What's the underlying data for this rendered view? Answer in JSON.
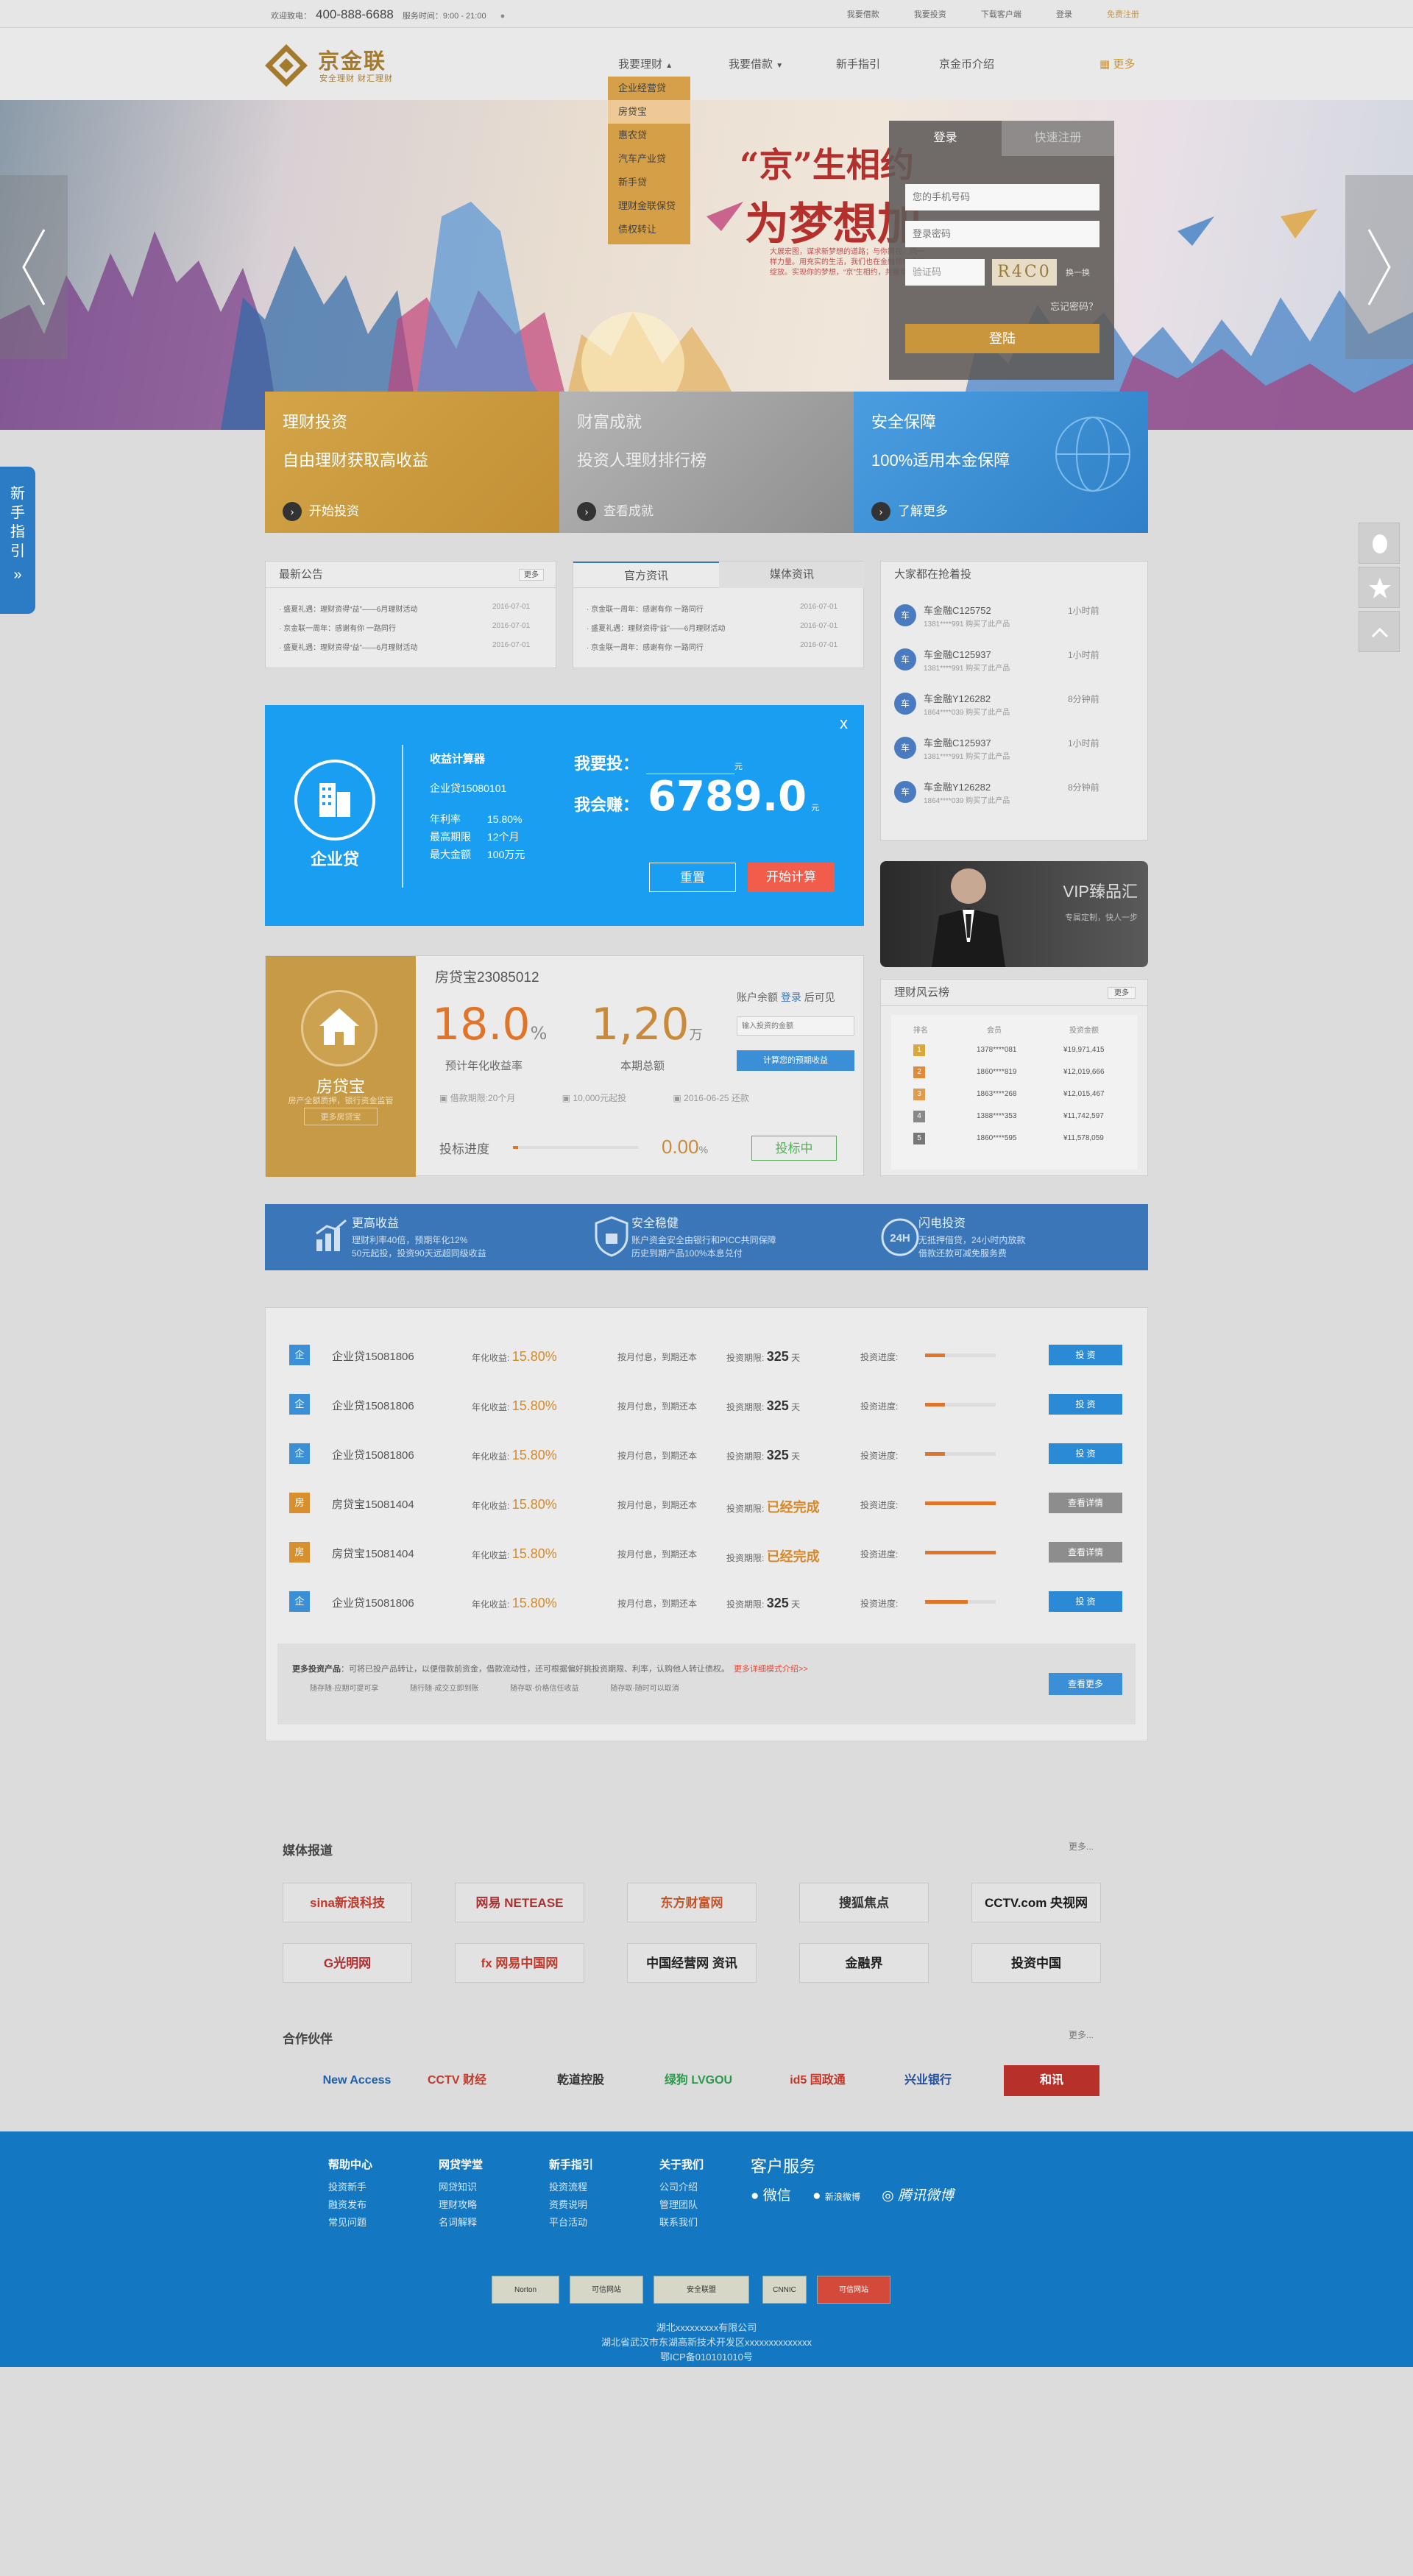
{
  "topbar": {
    "welcome": "欢迎致电：",
    "phone": "400-888-6688",
    "hours": "服务时间：9:00 - 21:00",
    "links": [
      "我要借款",
      "我要投资",
      "下载客户端",
      "登录",
      "免费注册"
    ]
  },
  "logo": {
    "name": "京金联",
    "slogan": "安全理财 财汇理财"
  },
  "nav": {
    "items": [
      "我要理财",
      "我要借款",
      "新手指引",
      "京金币介绍",
      "更多"
    ],
    "dropdown": [
      "企业经营贷",
      "房贷宝",
      "惠农贷",
      "汽车产业贷",
      "新手贷",
      "理财金联保贷",
      "债权转让"
    ]
  },
  "banner": {
    "headline1": "“京”生相约",
    "headline2": "为梦想加",
    "desc": "大展宏图，谋求新梦想的道路；与你同在，同一样力量。用充实的生活，我们也在金融领域精彩绽放。实现你的梦想，“京”生相约，共赢幸福。"
  },
  "login": {
    "tab_login": "登录",
    "tab_register": "快速注册",
    "phone_placeholder": "您的手机号码",
    "password_placeholder": "登录密码",
    "captcha_placeholder": "验证码",
    "captcha_text": "R4C0",
    "swap": "换一换",
    "forgot": "忘记密码？",
    "submit": "登陆"
  },
  "features": [
    {
      "title": "理财投资",
      "subtitle": "自由理财获取高收益",
      "action": "开始投资",
      "color": "#c99a3c"
    },
    {
      "title": "财富成就",
      "subtitle": "投资人理财排行榜",
      "action": "查看成就",
      "color": "#9a9a9a"
    },
    {
      "title": "安全保障",
      "subtitle": "100%适用本金保障",
      "action": "了解更多",
      "color": "#3a8fd4"
    }
  ],
  "side_guide": {
    "label": "新手指引",
    "arrow": "»"
  },
  "news": {
    "title": "最新公告",
    "more": "更多",
    "items": [
      {
        "text": "盛夏礼遇：理财资得“益”——6月理财活动",
        "date": "2016-07-01"
      },
      {
        "text": "京金联一周年：感谢有你 一路同行",
        "date": "2016-07-01"
      },
      {
        "text": "盛夏礼遇：理财资得“益”——6月理财活动",
        "date": "2016-07-01"
      }
    ]
  },
  "official": {
    "tab1": "官方资讯",
    "tab2": "媒体资讯",
    "items": [
      {
        "text": "京金联一周年：感谢有你 一路同行",
        "date": "2016-07-01"
      },
      {
        "text": "盛夏礼遇：理财资得“益”——6月理财活动",
        "date": "2016-07-01"
      },
      {
        "text": "京金联一周年：感谢有你 一路同行",
        "date": "2016-07-01"
      }
    ]
  },
  "rush": {
    "title": "大家都在抢着投",
    "items": [
      {
        "name": "车金融C125752",
        "phone": "1381****991 购买了此产品",
        "time": "1小时前"
      },
      {
        "name": "车金融C125937",
        "phone": "1381****991 购买了此产品",
        "time": "1小时前"
      },
      {
        "name": "车金融Y126282",
        "phone": "1864****039 购买了此产品",
        "time": "8分钟前"
      },
      {
        "name": "车金融C125937",
        "phone": "1381****991 购买了此产品",
        "time": "1小时前"
      },
      {
        "name": "车金融Y126282",
        "phone": "1864****039 购买了此产品",
        "time": "8分钟前"
      }
    ]
  },
  "modal": {
    "close": "x",
    "product_label": "企业贷",
    "calc_title": "收益计算器",
    "calc_name": "企业贷15080101",
    "rows": [
      {
        "k": "年利率",
        "v": "15.80%"
      },
      {
        "k": "最高期限",
        "v": "12个月"
      },
      {
        "k": "最大金额",
        "v": "100万元"
      }
    ],
    "invest_label": "我要投：",
    "invest_unit": "元",
    "earn_label": "我会赚：",
    "earn_value": "6789.0",
    "earn_unit": "元",
    "reset": "重置",
    "start": "开始计算"
  },
  "vip": {
    "title": "VIP臻品汇",
    "sub": "专属定制，快人一步"
  },
  "product": {
    "label": "房贷宝",
    "sub": "房产全额质押，银行资金监管",
    "btn": "更多房贷宝",
    "name": "房贷宝23085012",
    "rate": "18.0",
    "rate_unit": "%",
    "rate_label": "预计年化收益率",
    "amount": "1,20",
    "amount_unit": "万",
    "amount_label": "本期总额",
    "term": "借款期限:20个月",
    "min": "10,000元起投",
    "date": "2016-06-25 还款",
    "progress_label": "投标进度",
    "progress_value": "0.00",
    "progress_unit": "%",
    "progress_fraction": 0.04,
    "status": "投标中",
    "balance": "账户余额",
    "login": "登录",
    "balance_after": "后可见",
    "input_placeholder": "输入投资的金额",
    "calc_btn": "计算您的预期收益"
  },
  "ranking": {
    "title": "理财风云榜",
    "more": "更多",
    "headers": [
      "排名",
      "会员",
      "投资金额"
    ],
    "rows": [
      {
        "rank": "1",
        "user": "1378****081",
        "amount": "¥19,971,415"
      },
      {
        "rank": "2",
        "user": "1860****819",
        "amount": "¥12,019,666"
      },
      {
        "rank": "3",
        "user": "1863****268",
        "amount": "¥12,015,467"
      },
      {
        "rank": "4",
        "user": "1388****353",
        "amount": "¥11,742,597"
      },
      {
        "rank": "5",
        "user": "1860****595",
        "amount": "¥11,578,059"
      }
    ]
  },
  "strip": [
    {
      "title": "更高收益",
      "l1": "理财利率40倍，预期年化12%",
      "l2": "50元起投，投资90天远超同级收益"
    },
    {
      "title": "安全稳健",
      "l1": "账户资金安全由银行和PICC共同保障",
      "l2": "历史到期产品100%本息兑付"
    },
    {
      "title": "闪电投资",
      "l1": "无抵押借贷，24小时内放款",
      "l2": "借款还款可减免服务费"
    }
  ],
  "loans": [
    {
      "icon": "企",
      "name": "企业贷15081806",
      "rate_label": "年化收益:",
      "rate": "15.80%",
      "method": "按月付息，到期还本",
      "period_label": "投资期限:",
      "period": "325",
      "period_unit": "天",
      "progress_label": "投资进度:",
      "progress": 0.28,
      "action": "投 资",
      "kind": "invest"
    },
    {
      "icon": "企",
      "name": "企业贷15081806",
      "rate_label": "年化收益:",
      "rate": "15.80%",
      "method": "按月付息，到期还本",
      "period_label": "投资期限:",
      "period": "325",
      "period_unit": "天",
      "progress_label": "投资进度:",
      "progress": 0.28,
      "action": "投 资",
      "kind": "invest"
    },
    {
      "icon": "企",
      "name": "企业贷15081806",
      "rate_label": "年化收益:",
      "rate": "15.80%",
      "method": "按月付息，到期还本",
      "period_label": "投资期限:",
      "period": "325",
      "period_unit": "天",
      "progress_label": "投资进度:",
      "progress": 0.28,
      "action": "投 资",
      "kind": "invest"
    },
    {
      "icon": "房",
      "name": "房贷宝15081404",
      "rate_label": "年化收益:",
      "rate": "15.80%",
      "method": "按月付息，到期还本",
      "period_label": "投资期限:",
      "period": "已经完成",
      "period_unit": "",
      "progress_label": "投资进度:",
      "progress": 1.0,
      "action": "查看详情",
      "kind": "view"
    },
    {
      "icon": "房",
      "name": "房贷宝15081404",
      "rate_label": "年化收益:",
      "rate": "15.80%",
      "method": "按月付息，到期还本",
      "period_label": "投资期限:",
      "period": "已经完成",
      "period_unit": "",
      "progress_label": "投资进度:",
      "progress": 1.0,
      "action": "查看详情",
      "kind": "view"
    },
    {
      "icon": "企",
      "name": "企业贷15081806",
      "rate_label": "年化收益:",
      "rate": "15.80%",
      "method": "按月付息，到期还本",
      "period_label": "投资期限:",
      "period": "325",
      "period_unit": "天",
      "progress_label": "投资进度:",
      "progress": 0.6,
      "action": "投 资",
      "kind": "invest"
    }
  ],
  "more_products": {
    "title": "更多投资产品",
    "text": "：可将已投产品转让，以便借款前资金，借款流动性，还可根据偏好挑投资期限、利率，认购他人转让债权。",
    "link": "更多详细模式介绍>>",
    "items": [
      "随存随·应期可提可享",
      "随行随·成交立即到账",
      "随存取·价格信任收益",
      "随存取·随时可以取消"
    ],
    "btn": "查看更多"
  },
  "media": {
    "title": "媒体报道",
    "more": "更多...",
    "logos": [
      {
        "text": "sina新浪科技",
        "color": "#c0392b"
      },
      {
        "text": "网易 NETEASE",
        "color": "#a83232"
      },
      {
        "text": "东方财富网",
        "color": "#c0552b"
      },
      {
        "text": "搜狐焦点",
        "color": "#333"
      },
      {
        "text": "CCTV.com 央视网",
        "color": "#1a1a1a"
      },
      {
        "text": "G光明网",
        "color": "#b52c2c"
      },
      {
        "text": "fx 网易中国网",
        "color": "#c0392b"
      },
      {
        "text": "中国经营网 资讯",
        "color": "#222"
      },
      {
        "text": "金融界",
        "color": "#222"
      },
      {
        "text": "投资中国",
        "color": "#1a1a1a"
      }
    ]
  },
  "partners": {
    "title": "合作伙伴",
    "more": "更多...",
    "logos": [
      {
        "text": "New Access",
        "color": "#1f5fa8"
      },
      {
        "text": "CCTV 财经",
        "color": "#c0392b"
      },
      {
        "text": "乾道控股",
        "color": "#333"
      },
      {
        "text": "绿狗 LVGOU",
        "color": "#2a9a4a"
      },
      {
        "text": "id5 国政通",
        "color": "#c0392b"
      },
      {
        "text": "兴业银行",
        "color": "#1f4f9a"
      },
      {
        "text": "和讯",
        "color": "#fff"
      }
    ]
  },
  "footer": {
    "cols": [
      {
        "title": "帮助中心",
        "items": [
          "投资新手",
          "融资发布",
          "常见问题"
        ]
      },
      {
        "title": "网贷学堂",
        "items": [
          "网贷知识",
          "理财攻略",
          "名词解释"
        ]
      },
      {
        "title": "新手指引",
        "items": [
          "投资流程",
          "资费说明",
          "平台活动"
        ]
      },
      {
        "title": "关于我们",
        "items": [
          "公司介绍",
          "管理团队",
          "联系我们"
        ]
      }
    ],
    "service_title": "客户服务",
    "service": [
      "微信",
      "新浪微博",
      "腾讯微博"
    ],
    "badges": [
      "Norton",
      "可信网站",
      "安全联盟",
      "CNNIC",
      "可信网站"
    ],
    "copy": [
      "湖北xxxxxxxxx有限公司",
      "湖北省武汉市东湖高新技术开发区xxxxxxxxxxxxxx",
      "鄂ICP备010101010号"
    ]
  }
}
